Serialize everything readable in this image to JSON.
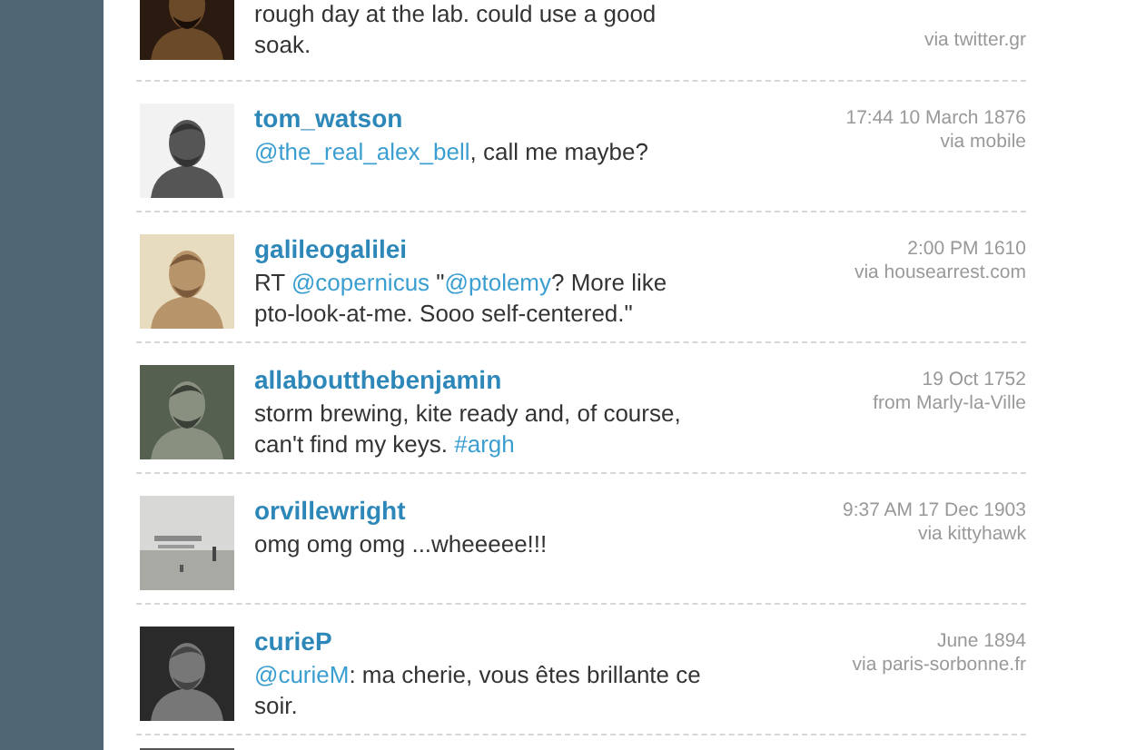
{
  "tweets": [
    {
      "text": [
        {
          "kind": "plain",
          "t": "rough day at the lab. could use a good soak."
        }
      ],
      "source": "via twitter.gr",
      "cut_top": true
    },
    {
      "username": "tom_watson",
      "text": [
        {
          "kind": "link",
          "t": "@the_real_alex_bell"
        },
        {
          "kind": "plain",
          "t": ", call me maybe?"
        }
      ],
      "time": "17:44 10 March 1876",
      "source": "via mobile"
    },
    {
      "username": "galileogalilei",
      "text": [
        {
          "kind": "plain",
          "t": "RT "
        },
        {
          "kind": "link",
          "t": "@copernicus"
        },
        {
          "kind": "plain",
          "t": " \""
        },
        {
          "kind": "link",
          "t": "@ptolemy"
        },
        {
          "kind": "plain",
          "t": "? More like pto-look-at-me. Sooo self-centered.\""
        }
      ],
      "time": "2:00 PM 1610",
      "source": "via housearrest.com"
    },
    {
      "username": "allaboutthebenjamin",
      "text": [
        {
          "kind": "plain",
          "t": "storm brewing, kite ready and, of course, can't find my keys. "
        },
        {
          "kind": "link",
          "t": "#argh"
        }
      ],
      "time": "19 Oct  1752",
      "source": "from Marly-la-Ville"
    },
    {
      "username": "orvillewright",
      "text": [
        {
          "kind": "plain",
          "t": "omg omg omg ...wheeeee!!!"
        }
      ],
      "time": "9:37 AM 17 Dec 1903",
      "source": "via kittyhawk"
    },
    {
      "username": "curieP",
      "text": [
        {
          "kind": "link",
          "t": "@curieM"
        },
        {
          "kind": "plain",
          "t": ": ma cherie, vous êtes brillante ce soir."
        }
      ],
      "time": "June 1894",
      "source": "via paris-sorbonne.fr"
    },
    {
      "cut_bottom": true
    }
  ]
}
